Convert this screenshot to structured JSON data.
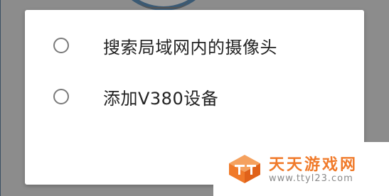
{
  "dialog": {
    "options": [
      {
        "label": "搜索局域网内的摄像头",
        "selected": false
      },
      {
        "label": "添加V380设备",
        "selected": false
      }
    ]
  },
  "watermark": {
    "title": "天天游戏网",
    "url": "www.ttyl23.com",
    "logo_icon": "tt-logo-icon",
    "accent_color": "#f07a2a"
  }
}
